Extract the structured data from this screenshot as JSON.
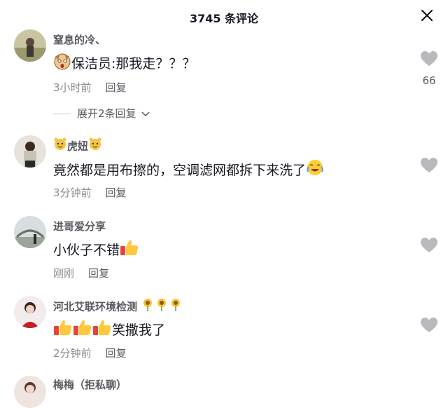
{
  "header": {
    "title": "3745 条评论"
  },
  "comments": [
    {
      "username": "窒息的冷、",
      "text": "保洁员:那我走？？？",
      "time": "3小时前",
      "reply": "回复",
      "likes": "66",
      "expand": "展开2条回复"
    },
    {
      "username": "虎妞",
      "text": "竟然都是用布擦的，空调滤网都拆下来洗了",
      "time": "3分钟前",
      "reply": "回复"
    },
    {
      "username": "进哥爱分享",
      "text": "小伙子不错",
      "time": "刚刚",
      "reply": "回复"
    },
    {
      "username": "河北艾联环境检测",
      "text": "笑撒我了",
      "time": "2分钟前",
      "reply": "回复"
    },
    {
      "username": "梅梅（拒私聊）"
    }
  ]
}
